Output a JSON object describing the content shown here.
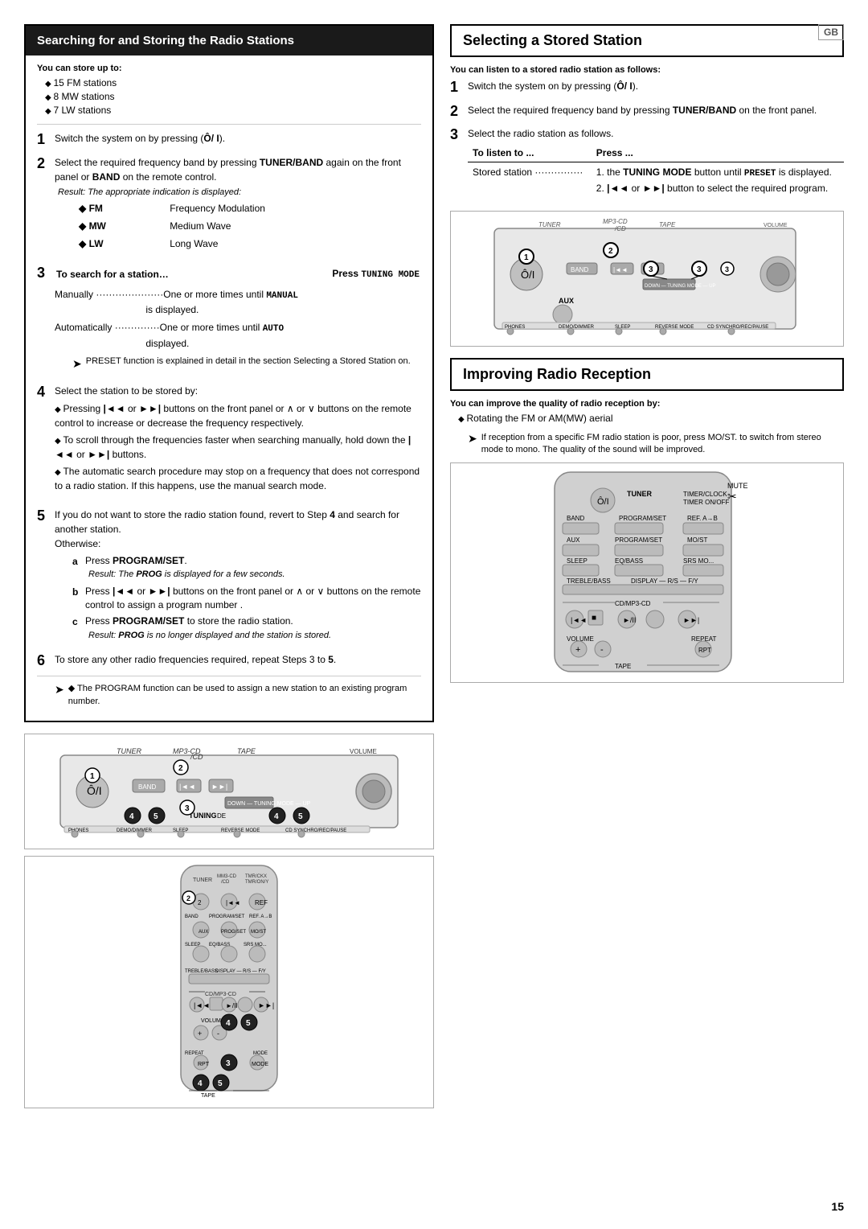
{
  "page": {
    "number": "15",
    "gb_badge": "GB"
  },
  "left_section": {
    "header": "Searching for and Storing the Radio Stations",
    "you_can_store": "You can store up to:",
    "stations_list": [
      "15 FM stations",
      "8 MW stations",
      "7 LW stations"
    ],
    "steps": [
      {
        "num": "1",
        "text": "Switch the system on by pressing (Ô/ I)."
      },
      {
        "num": "2",
        "text": "Select the required frequency band by pressing TUNER/BAND again on the front panel or BAND on the remote control.",
        "result": "Result: The appropriate indication is displayed:",
        "bands": [
          {
            "symbol": "◆ FM",
            "desc": "Frequency Modulation"
          },
          {
            "symbol": "◆ MW",
            "desc": "Medium Wave"
          },
          {
            "symbol": "◆ LW",
            "desc": "Long Wave"
          }
        ]
      },
      {
        "num": "3",
        "label_left": "To search for a station…",
        "label_right": "Press TUNING MODE",
        "manually": "Manually ………………… One or more times until MANUAL is displayed.",
        "automatically": "Automatically …………… One or more times until AUTO is displayed."
      },
      {
        "num": "4",
        "text": "Select the station to be stored by:",
        "bullets": [
          "Pressing |◄◄ or ►►| buttons on the front panel or ∧ or ∨ buttons on the remote control to increase or decrease the frequency respectively.",
          "To scroll through the frequencies faster when searching manually, hold down the |◄◄ or ►►| buttons.",
          "The automatic search procedure may stop on a frequency that does not correspond to a radio station. If this happens, use the manual search mode."
        ]
      },
      {
        "num": "5",
        "text": "If you do not want to store the radio station found, revert to Step 4 and search for another station.",
        "otherwise": "Otherwise:",
        "sub_steps": [
          {
            "letter": "a",
            "text": "Press PROGRAM/SET.",
            "result": "Result: The PROG is displayed for a few seconds."
          },
          {
            "letter": "b",
            "text": "Press |◄◄ or ►►| buttons on the front panel or ∧ or ∨ buttons on the remote control to assign a program number."
          },
          {
            "letter": "c",
            "text": "Press PROGRAM/SET to store the radio station.",
            "result": "Result: PROG is no longer displayed and the station is stored."
          }
        ]
      },
      {
        "num": "6",
        "text": "To store any other radio frequencies required, repeat Steps 3 to 5."
      }
    ],
    "note": "◆ The PROGRAM function can be used to assign a new station to an existing program number.",
    "preset_note": "PRESET function is explained in detail in the section Selecting a Stored Station on."
  },
  "right_section": {
    "selecting_header": "Selecting a Stored Station",
    "you_can_listen": "You can listen to a stored radio station as follows:",
    "selecting_steps": [
      {
        "num": "1",
        "text": "Switch the system on by pressing (Ô/ I)."
      },
      {
        "num": "2",
        "text": "Select the required frequency band by pressing TUNER/BAND on the front panel."
      },
      {
        "num": "3",
        "text": "Select the radio station as follows.",
        "table_headers": [
          "To listen to ...",
          "Press ..."
        ],
        "table_rows": [
          {
            "listen": "Stored station ………………",
            "press_lines": [
              "1. the TUNING MODE button until PRESET is displayed.",
              "2. |◄◄ or ►►| button to select the required program."
            ]
          }
        ]
      }
    ],
    "improving_header": "Improving Radio Reception",
    "you_can_improve": "You can improve the quality of radio reception by:",
    "improving_bullets": [
      "Rotating the FM or AM(MW) aerial"
    ],
    "improving_note": "If reception from a specific FM radio station is poor, press MO/ST. to switch from stereo mode to mono. The quality of the sound will be improved."
  }
}
